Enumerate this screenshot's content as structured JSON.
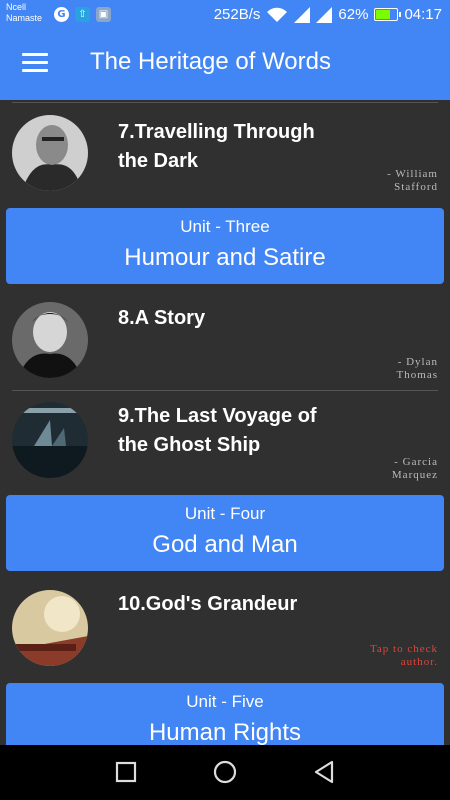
{
  "status_bar": {
    "carrier_line1": "Ncell",
    "carrier_line2": "Namaste",
    "network_speed": "252B/s",
    "battery_percent": "62%",
    "battery_level": 0.62,
    "time": "04:17",
    "icons": [
      "google-icon",
      "upload-icon",
      "image-icon",
      "wifi-icon",
      "signal-icon",
      "signal-icon",
      "battery-icon"
    ]
  },
  "app_bar": {
    "title": "The Heritage of Words",
    "menu_icon": "hamburger-menu-icon"
  },
  "colors": {
    "accent": "#4285F4",
    "background": "#303030",
    "tap_hint": "#e0433a"
  },
  "list": [
    {
      "type": "lesson",
      "title": "7.Travelling Through the Dark",
      "author_line1": "- William",
      "author_line2": "Stafford"
    },
    {
      "type": "unit",
      "label": "Unit - Three",
      "name": "Humour and Satire"
    },
    {
      "type": "lesson",
      "title": "8.A Story",
      "author_line1": "- Dylan",
      "author_line2": "Thomas"
    },
    {
      "type": "lesson",
      "title": "9.The Last Voyage of the Ghost Ship",
      "author_line1": "- Garcia",
      "author_line2": "Marquez"
    },
    {
      "type": "unit",
      "label": "Unit - Four",
      "name": "God and Man"
    },
    {
      "type": "lesson",
      "title": "10.God's Grandeur",
      "author_line1": "Tap to check",
      "author_line2": "author."
    },
    {
      "type": "unit",
      "label": "Unit - Five",
      "name": "Human Rights"
    }
  ],
  "nav_bar": {
    "icons": [
      "recents-square-icon",
      "home-circle-icon",
      "back-triangle-icon"
    ]
  }
}
